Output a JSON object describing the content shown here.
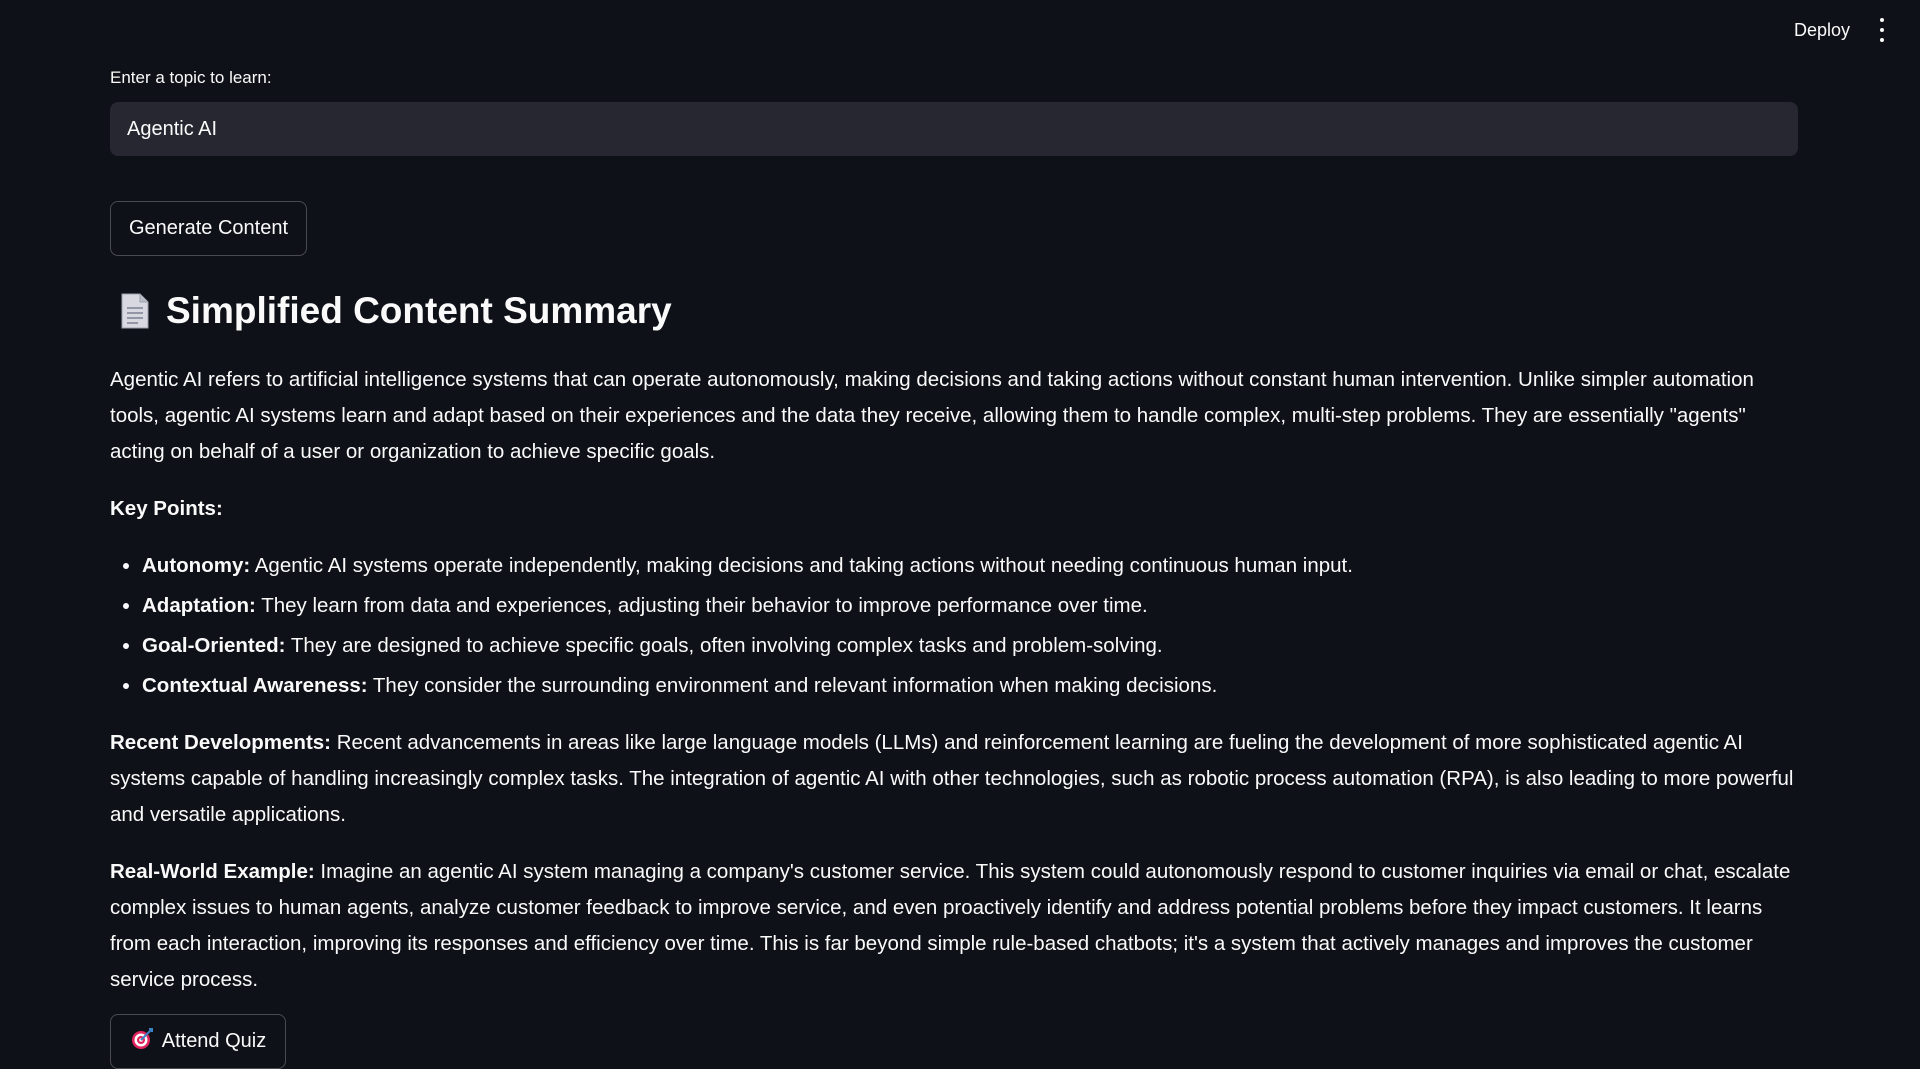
{
  "header": {
    "deploy_label": "Deploy",
    "menu_icon": "kebab-menu-icon"
  },
  "input": {
    "label": "Enter a topic to learn:",
    "value": "Agentic AI"
  },
  "buttons": {
    "generate_label": "Generate Content",
    "quiz_label": "Attend Quiz",
    "quiz_icon": "target-icon"
  },
  "summary": {
    "icon": "document-icon",
    "title": "Simplified Content Summary",
    "intro": "Agentic AI refers to artificial intelligence systems that can operate autonomously, making decisions and taking actions without constant human intervention. Unlike simpler automation tools, agentic AI systems learn and adapt based on their experiences and the data they receive, allowing them to handle complex, multi-step problems. They are essentially \"agents\" acting on behalf of a user or organization to achieve specific goals.",
    "key_points_heading": "Key Points:",
    "key_points": [
      {
        "term": "Autonomy:",
        "text": " Agentic AI systems operate independently, making decisions and taking actions without needing continuous human input."
      },
      {
        "term": "Adaptation:",
        "text": " They learn from data and experiences, adjusting their behavior to improve performance over time."
      },
      {
        "term": "Goal-Oriented:",
        "text": " They are designed to achieve specific goals, often involving complex tasks and problem-solving."
      },
      {
        "term": "Contextual Awareness:",
        "text": " They consider the surrounding environment and relevant information when making decisions."
      }
    ],
    "recent_term": "Recent Developments:",
    "recent_text": " Recent advancements in areas like large language models (LLMs) and reinforcement learning are fueling the development of more sophisticated agentic AI systems capable of handling increasingly complex tasks. The integration of agentic AI with other technologies, such as robotic process automation (RPA), is also leading to more powerful and versatile applications.",
    "example_term": "Real-World Example:",
    "example_text": " Imagine an agentic AI system managing a company's customer service. This system could autonomously respond to customer inquiries via email or chat, escalate complex issues to human agents, analyze customer feedback to improve service, and even proactively identify and address potential problems before they impact customers. It learns from each interaction, improving its responses and efficiency over time. This is far beyond simple rule-based chatbots; it's a system that actively manages and improves the customer service process."
  }
}
